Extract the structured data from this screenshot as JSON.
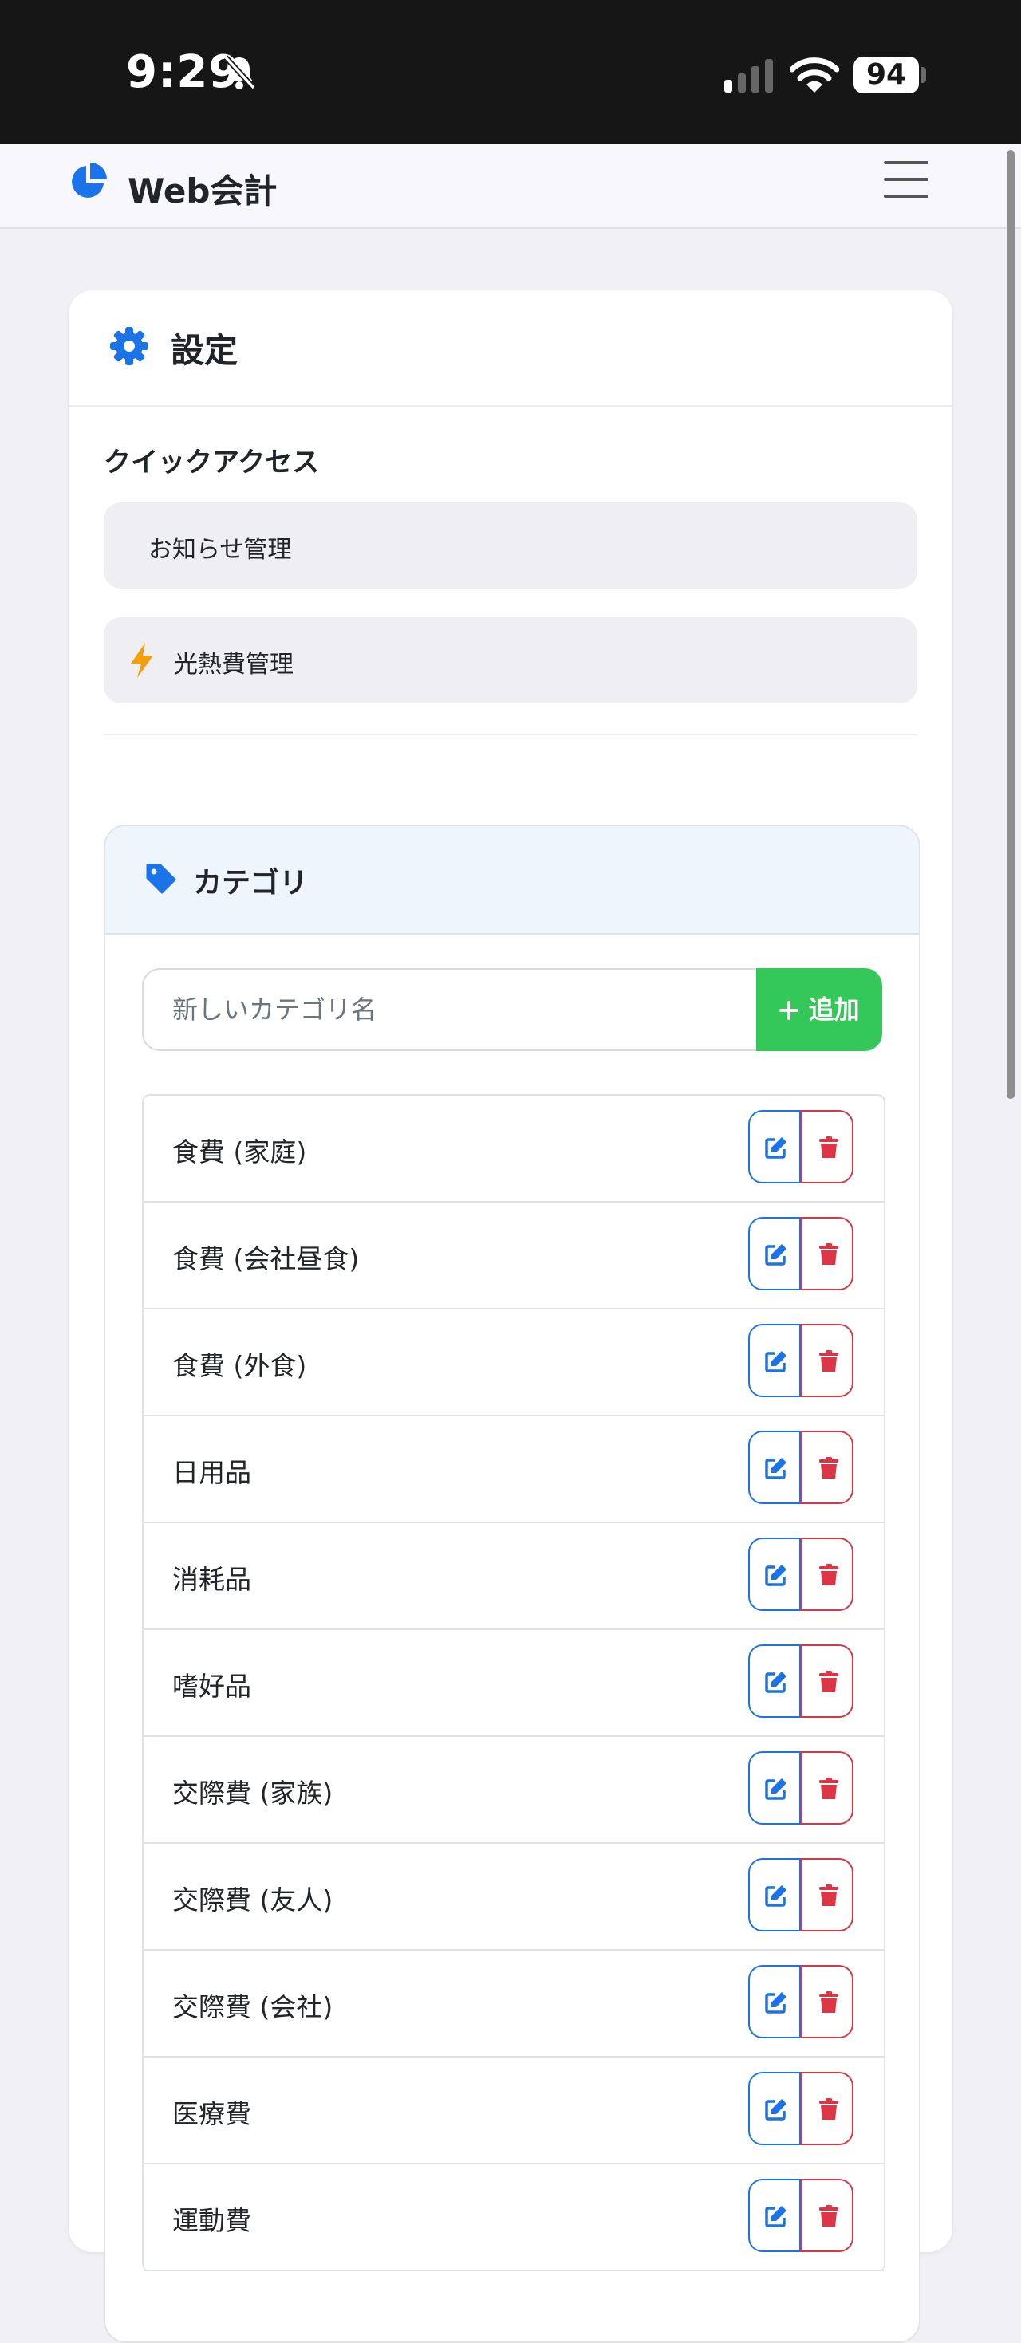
{
  "status_bar": {
    "time": "9:29",
    "battery": "94"
  },
  "navbar": {
    "brand": "Web会計"
  },
  "settings": {
    "title": "設定",
    "quick_access": {
      "title": "クイックアクセス",
      "items": [
        {
          "label": "お知らせ管理",
          "icon": "none"
        },
        {
          "label": "光熱費管理",
          "icon": "lightning-icon"
        }
      ]
    },
    "category": {
      "title": "カテゴリ",
      "input_placeholder": "新しいカテゴリ名",
      "add_label": "追加",
      "items": [
        "食費 (家庭)",
        "食費 (会社昼食)",
        "食費 (外食)",
        "日用品",
        "消耗品",
        "嗜好品",
        "交際費 (家族)",
        "交際費 (友人)",
        "交際費 (会社)",
        "医療費",
        "運動費"
      ]
    }
  },
  "colors": {
    "accent": "#1a73e8",
    "add": "#34c759",
    "danger": "#dc3545",
    "lightning": "#f59e0b"
  }
}
